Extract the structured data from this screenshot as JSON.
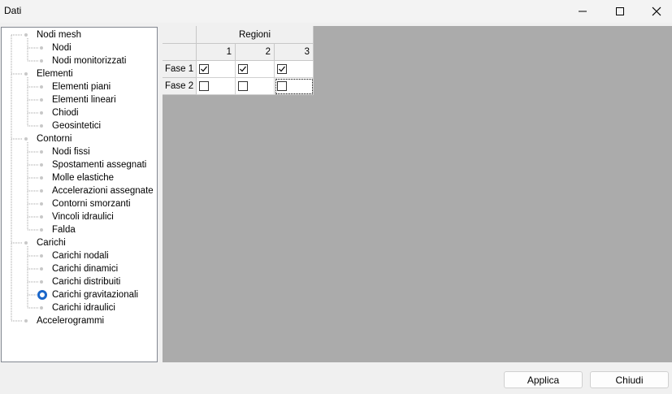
{
  "window": {
    "title": "Dati"
  },
  "tree": {
    "nodes": [
      {
        "label": "Nodi mesh",
        "level": 0
      },
      {
        "label": "Nodi",
        "level": 1
      },
      {
        "label": "Nodi monitorizzati",
        "level": 1
      },
      {
        "label": "Elementi",
        "level": 0
      },
      {
        "label": "Elementi piani",
        "level": 1
      },
      {
        "label": "Elementi lineari",
        "level": 1
      },
      {
        "label": "Chiodi",
        "level": 1
      },
      {
        "label": "Geosintetici",
        "level": 1
      },
      {
        "label": "Contorni",
        "level": 0
      },
      {
        "label": "Nodi fissi",
        "level": 1
      },
      {
        "label": "Spostamenti assegnati",
        "level": 1
      },
      {
        "label": "Molle elastiche",
        "level": 1
      },
      {
        "label": "Accelerazioni assegnate",
        "level": 1
      },
      {
        "label": "Contorni smorzanti",
        "level": 1
      },
      {
        "label": "Vincoli idraulici",
        "level": 1
      },
      {
        "label": "Falda",
        "level": 1
      },
      {
        "label": "Carichi",
        "level": 0
      },
      {
        "label": "Carichi nodali",
        "level": 1
      },
      {
        "label": "Carichi dinamici",
        "level": 1
      },
      {
        "label": "Carichi distribuiti",
        "level": 1
      },
      {
        "label": "Carichi gravitazionali",
        "level": 1,
        "selected": true
      },
      {
        "label": "Carichi idraulici",
        "level": 1
      },
      {
        "label": "Accelerogrammi",
        "level": 0
      }
    ]
  },
  "grid": {
    "group_header": "Regioni",
    "columns": [
      "1",
      "2",
      "3"
    ],
    "rows": [
      {
        "label": "Fase 1",
        "checks": [
          true,
          true,
          true
        ]
      },
      {
        "label": "Fase 2",
        "checks": [
          false,
          false,
          false
        ]
      }
    ],
    "focused_cell": {
      "row": 1,
      "col": 2
    }
  },
  "buttons": {
    "apply": "Applica",
    "close": "Chiudi"
  },
  "colors": {
    "accent": "#1a66c9",
    "grid_background": "#ababab"
  }
}
